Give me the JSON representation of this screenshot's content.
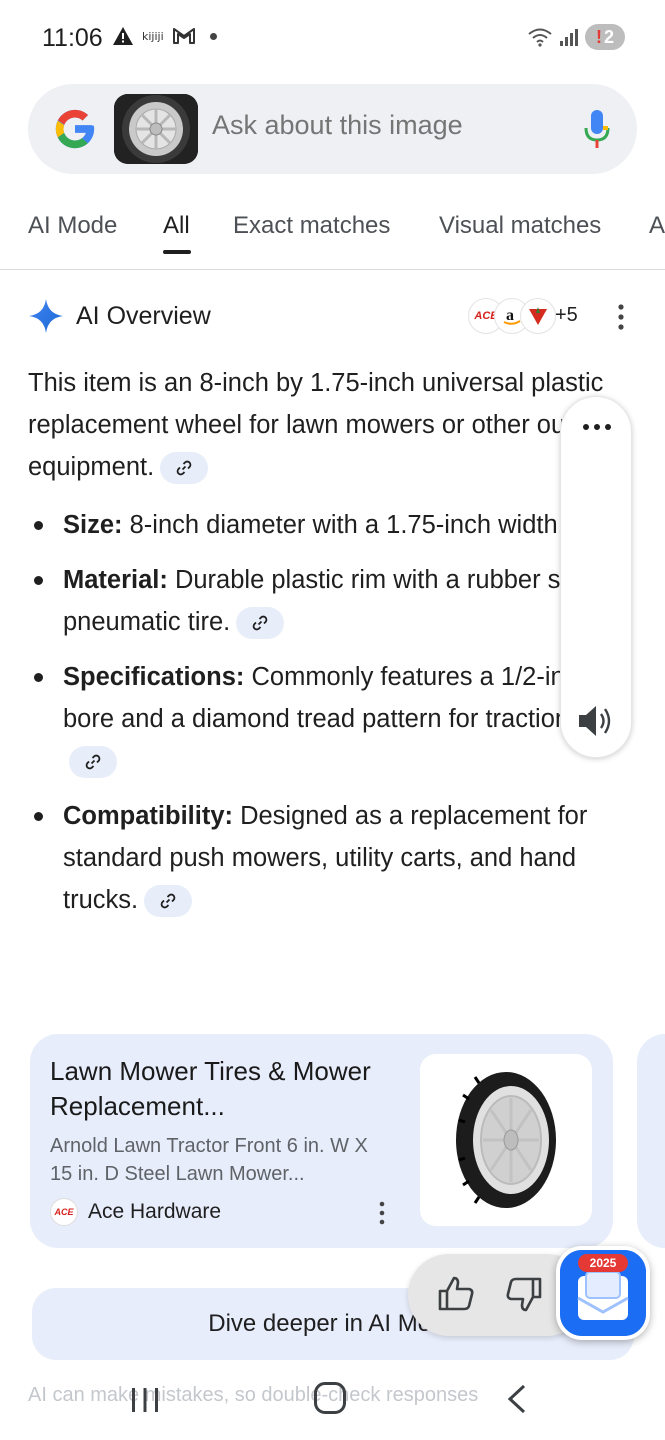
{
  "status_bar": {
    "time": "11:06",
    "notification_app": "kijiji",
    "battery_alert": "!",
    "battery_level": "2"
  },
  "search": {
    "placeholder": "Ask about this image"
  },
  "tabs": [
    {
      "label": "AI Mode"
    },
    {
      "label": "All"
    },
    {
      "label": "Exact matches"
    },
    {
      "label": "Visual matches"
    },
    {
      "label": "A"
    }
  ],
  "ai_overview": {
    "title": "AI Overview",
    "sources_more": "+5",
    "source_icons": [
      "ace-hardware-logo",
      "amazon-logo",
      "canadian-tire-logo"
    ],
    "intro": "This item is an 8-inch by 1.75-inch universal plastic replacement wheel for lawn mowers or other outdoor equipment.",
    "bullets": [
      {
        "label": "Size:",
        "text": " 8-inch diameter with a 1.75-inch width."
      },
      {
        "label": "Material:",
        "text": " Durable plastic rim with a rubber semi-pneumatic tire."
      },
      {
        "label": "Specifications:",
        "text": " Commonly features a 1/2-inch bore and a diamond tread pattern for traction."
      },
      {
        "label": "Compatibility:",
        "text": " Designed as a replacement for standard push mowers, utility carts, and hand trucks."
      }
    ]
  },
  "card": {
    "title": "Lawn Mower Tires & Mower Replacement...",
    "description": "Arnold Lawn Tractor Front 6 in. W X 15 in. D Steel Lawn Mower...",
    "source": "Ace Hardware",
    "source_logo": "ACE"
  },
  "dive_deeper": "Dive deeper in AI Mode",
  "disclaimer": "AI can make mistakes, so double-check responses",
  "app_bubble_badge": "2025",
  "colors": {
    "accent_blue": "#1b6ef3",
    "card_bg": "#e8edfb",
    "link_chip_bg": "#e8eef9"
  }
}
